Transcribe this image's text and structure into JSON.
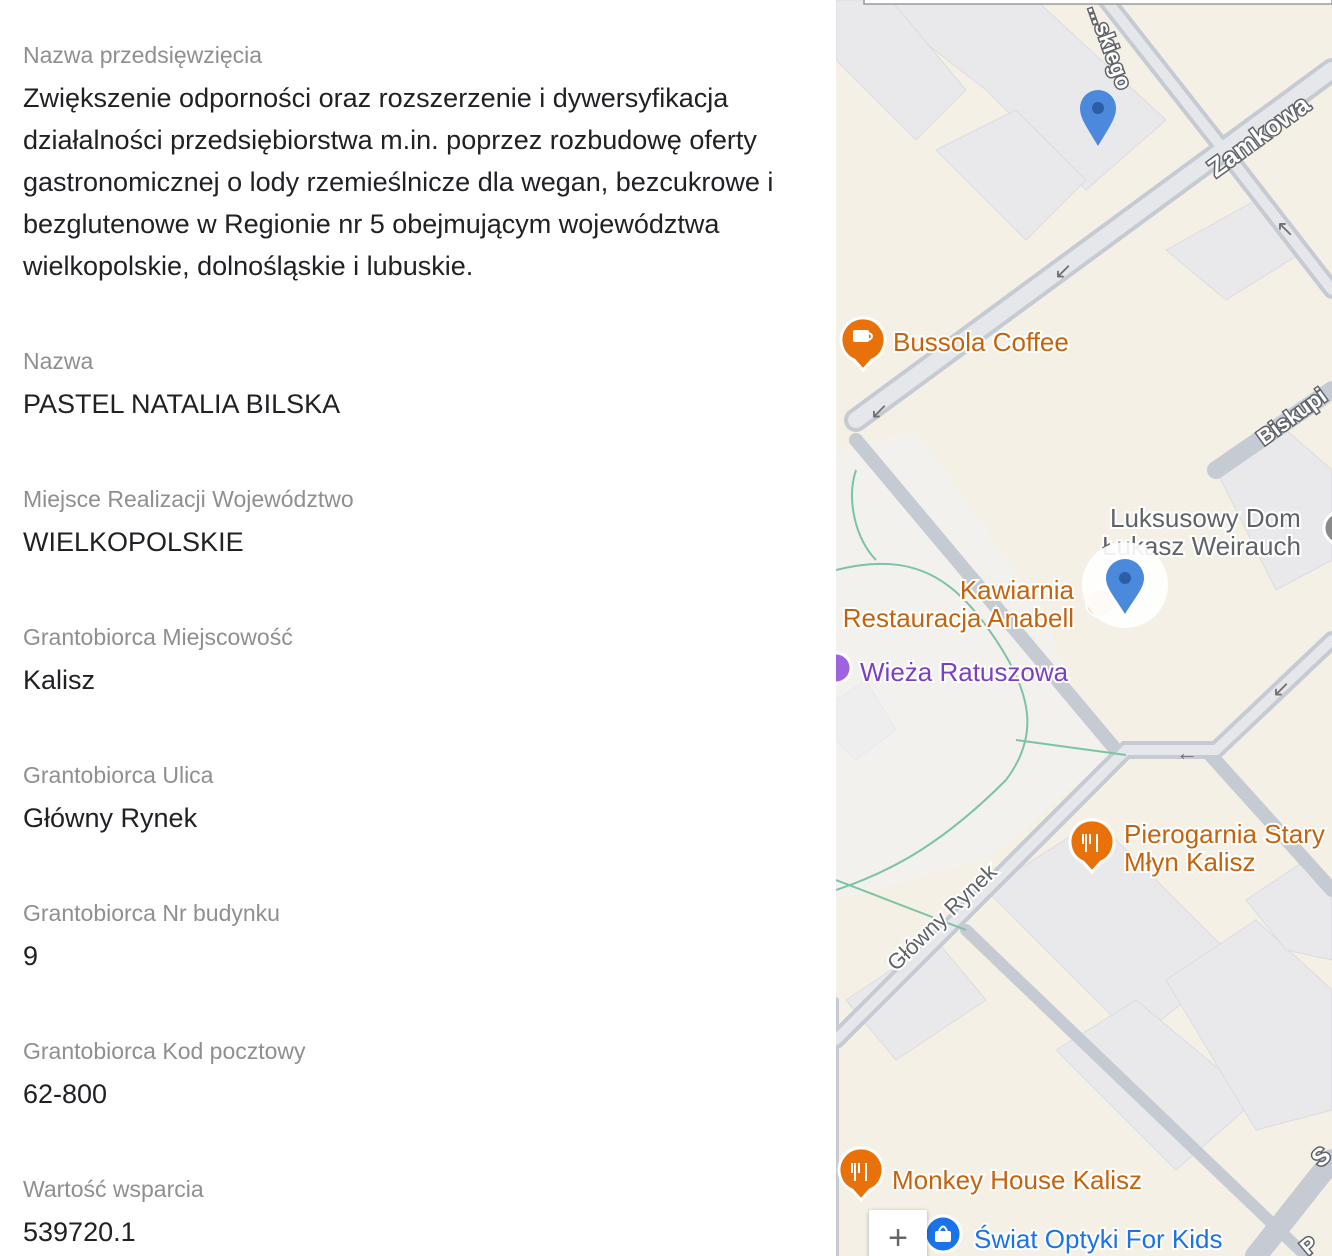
{
  "details": {
    "fields": [
      {
        "label": "Nazwa przedsięwzięcia",
        "value": "Zwiększenie odporności oraz rozszerzenie i dywersyfikacja działalności przedsiębiorstwa m.in. poprzez rozbudowę oferty gastronomicznej o lody rzemieślnicze dla wegan, bezcukrowe i bezglutenowe w Regionie nr 5 obejmującym województwa wielkopolskie, dolnośląskie i lubuskie."
      },
      {
        "label": "Nazwa",
        "value": "PASTEL NATALIA BILSKA"
      },
      {
        "label": "Miejsce Realizacji Województwo",
        "value": "WIELKOPOLSKIE"
      },
      {
        "label": "Grantobiorca Miejscowość",
        "value": "Kalisz"
      },
      {
        "label": "Grantobiorca Ulica",
        "value": "Główny Rynek"
      },
      {
        "label": "Grantobiorca Nr budynku",
        "value": "9"
      },
      {
        "label": "Grantobiorca Kod pocztowy",
        "value": "62-800"
      },
      {
        "label": "Wartość wsparcia",
        "value": "539720.1"
      }
    ]
  },
  "map": {
    "streets": {
      "top_street": "...skiego",
      "zamkowa": "Zamkowa",
      "biskupia": "Biskupi",
      "glowny_rynek": "Główny Rynek",
      "bottom_right": "S",
      "bottom_right_2": "P"
    },
    "places": {
      "bussola": "Bussola Coffee",
      "luksusowy_1": "Luksusowy Dom",
      "luksusowy_2": "Łukasz Weirauch",
      "kawiarnia_1": "Kawiarnia",
      "kawiarnia_2": "Restauracja Anabell",
      "wieza": "Wieża Ratuszowa",
      "pierogarnia_1": "Pierogarnia Stary",
      "pierogarnia_2": "Młyn Kalisz",
      "monkey": "Monkey House Kalisz",
      "swiat": "Świat Optyki For Kids"
    },
    "zoom_in_symbol": "+",
    "colors": {
      "food": "#e8710a",
      "poi_text": "#c5630c",
      "purple": "#7b3fc4",
      "blue": "#1a73e8",
      "marker": "#4a89dc"
    }
  }
}
